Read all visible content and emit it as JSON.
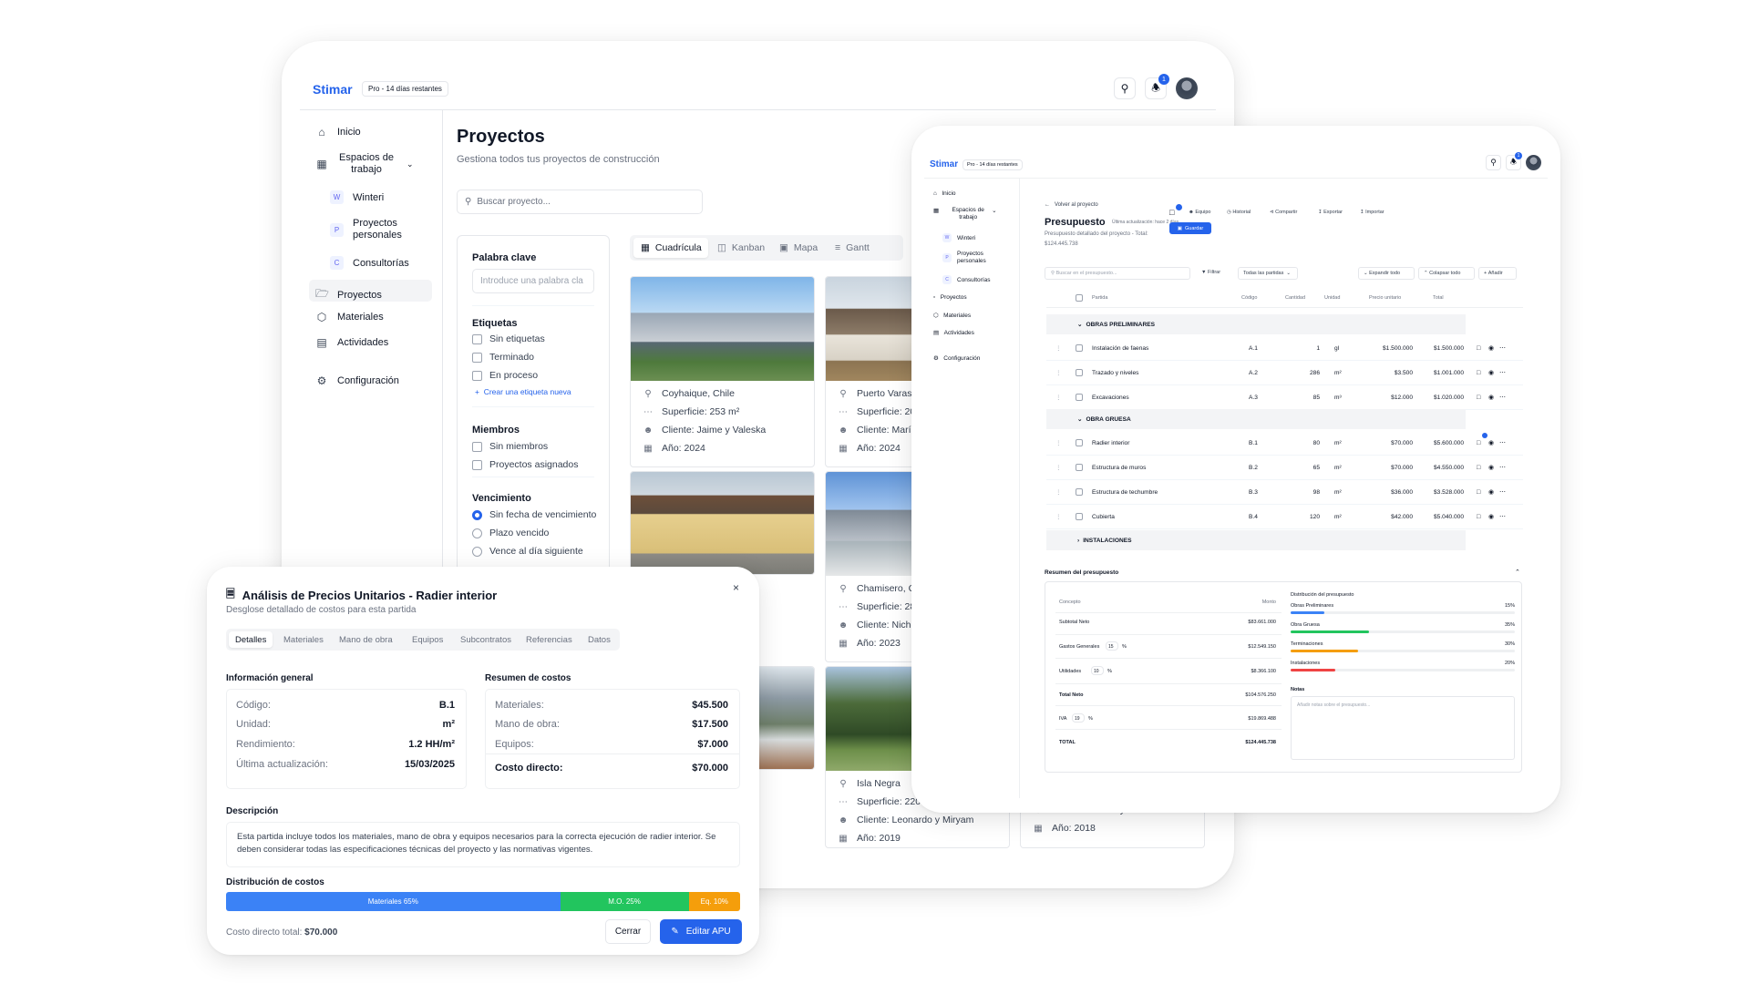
{
  "main": {
    "brand": "Stimar",
    "plan": "Pro - 14 días restantes",
    "notif_count": "1",
    "sidebar": [
      {
        "label": "Inicio"
      },
      {
        "label": "Espacios de trabajo"
      },
      {
        "label": "Winteri",
        "badge": "W"
      },
      {
        "label": "Proyectos personales",
        "badge": "P"
      },
      {
        "label": "Consultorías",
        "badge": "C"
      },
      {
        "label": "Proyectos"
      },
      {
        "label": "Materiales"
      },
      {
        "label": "Actividades"
      },
      {
        "label": "Configuración"
      }
    ],
    "title": "Proyectos",
    "subtitle": "Gestiona todos tus proyectos de construcción",
    "search_placeholder": "Buscar proyecto...",
    "filters": {
      "keyword_title": "Palabra clave",
      "keyword_placeholder": "Introduce una palabra cla",
      "tags_title": "Etiquetas",
      "tags": [
        "Sin etiquetas",
        "Terminado",
        "En proceso"
      ],
      "create_tag": "Crear una etiqueta nueva",
      "members_title": "Miembros",
      "members": [
        "Sin miembros",
        "Proyectos asignados"
      ],
      "due_title": "Vencimiento",
      "due": [
        "Sin fecha de vencimiento",
        "Plazo vencido",
        "Vence al día siguiente"
      ]
    },
    "views": [
      "Cuadrícula",
      "Kanban",
      "Mapa",
      "Gantt"
    ],
    "projects": [
      {
        "loc": "Coyhaique, Chile",
        "area": "Superficie: 253 m²",
        "client": "Cliente: Jaime y Valeska",
        "year": "Año: 2024"
      },
      {
        "loc": "Puerto Varas, C",
        "area": "Superficie: 20",
        "client": "Cliente: María",
        "year": "Año: 2024"
      },
      {
        "loc": "Chamisero, Ch",
        "area": "Superficie: 28",
        "client": "Cliente: Nichol",
        "year": "Año: 2023"
      },
      {
        "loc": "Isla Negra",
        "area": "Superficie: 220",
        "client": "Cliente: Leonardo y Miryam",
        "year": "Año: 2019"
      },
      {
        "client": "Cliente: Andrea y Francisco",
        "year": "Año: 2018"
      }
    ]
  },
  "budget": {
    "brand": "Stimar",
    "plan": "Pro - 14 días restantes",
    "notif_count": "1",
    "sidebar": [
      "Inicio",
      "Espacios de trabajo",
      "Winteri",
      "Proyectos personales",
      "Consultorías",
      "Proyectos",
      "Materiales",
      "Actividades",
      "Configuración"
    ],
    "back": "Volver al proyecto",
    "title": "Presupuesto",
    "last_update": "Última actualización: hace 2 días",
    "desc": "Presupuesto detallado del proyecto - Total:",
    "total_line": "$124.445.738",
    "save": "Guardar",
    "toolbar": [
      "Equipo",
      "Historial",
      "Compartir",
      "Exportar",
      "Importar"
    ],
    "search_placeholder": "Buscar en el presupuesto...",
    "filter": "Filtrar",
    "partidas": "Todas las partidas",
    "expand": "Expandir todo",
    "collapse": "Colapsar todo",
    "add": "Añadir",
    "headers": [
      "Partida",
      "Código",
      "Cantidad",
      "Unidad",
      "Precio unitario",
      "Total"
    ],
    "groups": [
      "OBRAS PRELIMINARES",
      "OBRA GRUESA",
      "INSTALACIONES"
    ],
    "rows": [
      {
        "name": "Instalación de faenas",
        "code": "A.1",
        "qty": "1",
        "unit": "gl",
        "price": "$1.500.000",
        "total": "$1.500.000"
      },
      {
        "name": "Trazado y niveles",
        "code": "A.2",
        "qty": "286",
        "unit": "m²",
        "price": "$3.500",
        "total": "$1.001.000"
      },
      {
        "name": "Excavaciones",
        "code": "A.3",
        "qty": "85",
        "unit": "m³",
        "price": "$12.000",
        "total": "$1.020.000"
      },
      {
        "name": "Radier interior",
        "code": "B.1",
        "qty": "80",
        "unit": "m²",
        "price": "$70.000",
        "total": "$5.600.000"
      },
      {
        "name": "Estructura de muros",
        "code": "B.2",
        "qty": "65",
        "unit": "m²",
        "price": "$70.000",
        "total": "$4.550.000"
      },
      {
        "name": "Estructura de techumbre",
        "code": "B.3",
        "qty": "98",
        "unit": "m²",
        "price": "$36.000",
        "total": "$3.528.000"
      },
      {
        "name": "Cubierta",
        "code": "B.4",
        "qty": "120",
        "unit": "m²",
        "price": "$42.000",
        "total": "$5.040.000"
      }
    ],
    "summary_title": "Resumen del presupuesto",
    "summary_headers": [
      "Concepto",
      "Monto"
    ],
    "summary": [
      {
        "label": "Subtotal Neto",
        "value": "$83.661.000"
      },
      {
        "label": "Gastos Generales",
        "pct": "15",
        "value": "$12.549.150"
      },
      {
        "label": "Utilidades",
        "pct": "10",
        "value": "$8.366.100"
      },
      {
        "label": "Total Neto",
        "value": "$104.576.250"
      },
      {
        "label": "IVA",
        "pct": "19",
        "value": "$19.869.488"
      },
      {
        "label": "TOTAL",
        "value": "$124.445.738"
      }
    ],
    "pct_sign": "%",
    "dist_title": "Distribución del presupuesto",
    "dist": [
      {
        "label": "Obras Preliminares",
        "pct": "15%",
        "value": 15,
        "color": "#3b82f6"
      },
      {
        "label": "Obra Gruesa",
        "pct": "35%",
        "value": 35,
        "color": "#22c55e"
      },
      {
        "label": "Terminaciones",
        "pct": "30%",
        "value": 30,
        "color": "#f59e0b"
      },
      {
        "label": "Instalaciones",
        "pct": "20%",
        "value": 20,
        "color": "#ef4444"
      }
    ],
    "notes_title": "Notas",
    "notes_placeholder": "Añadir notas sobre el presupuesto..."
  },
  "dialog": {
    "title": "Análisis de Precios Unitarios - Radier interior",
    "subtitle": "Desglose detallado de costos para esta partida",
    "tabs": [
      "Detalles",
      "Materiales",
      "Mano de obra",
      "Equipos",
      "Subcontratos",
      "Referencias",
      "Datos"
    ],
    "info_title": "Información general",
    "info": [
      {
        "k": "Código:",
        "v": "B.1"
      },
      {
        "k": "Unidad:",
        "v": "m²"
      },
      {
        "k": "Rendimiento:",
        "v": "1.2 HH/m²"
      },
      {
        "k": "Última actualización:",
        "v": "15/03/2025"
      }
    ],
    "costs_title": "Resumen de costos",
    "costs": [
      {
        "k": "Materiales:",
        "v": "$45.500"
      },
      {
        "k": "Mano de obra:",
        "v": "$17.500"
      },
      {
        "k": "Equipos:",
        "v": "$7.000"
      }
    ],
    "direct_label": "Costo directo:",
    "direct_value": "$70.000",
    "desc_title": "Descripción",
    "desc": "Esta partida incluye todos los materiales, mano de obra y equipos necesarios para la correcta ejecución de radier interior. Se deben considerar todas las especificaciones técnicas del proyecto y las normativas vigentes.",
    "dist_title": "Distribución de costos",
    "dist": [
      {
        "label": "Materiales 65%",
        "value": 65,
        "color": "#3b82f6"
      },
      {
        "label": "M.O. 25%",
        "value": 25,
        "color": "#22c55e"
      },
      {
        "label": "Eq. 10%",
        "value": 10,
        "color": "#f59e0b"
      }
    ],
    "total_label": "Costo directo total:",
    "total_value": "$70.000",
    "close": "Cerrar",
    "edit": "Editar APU"
  }
}
